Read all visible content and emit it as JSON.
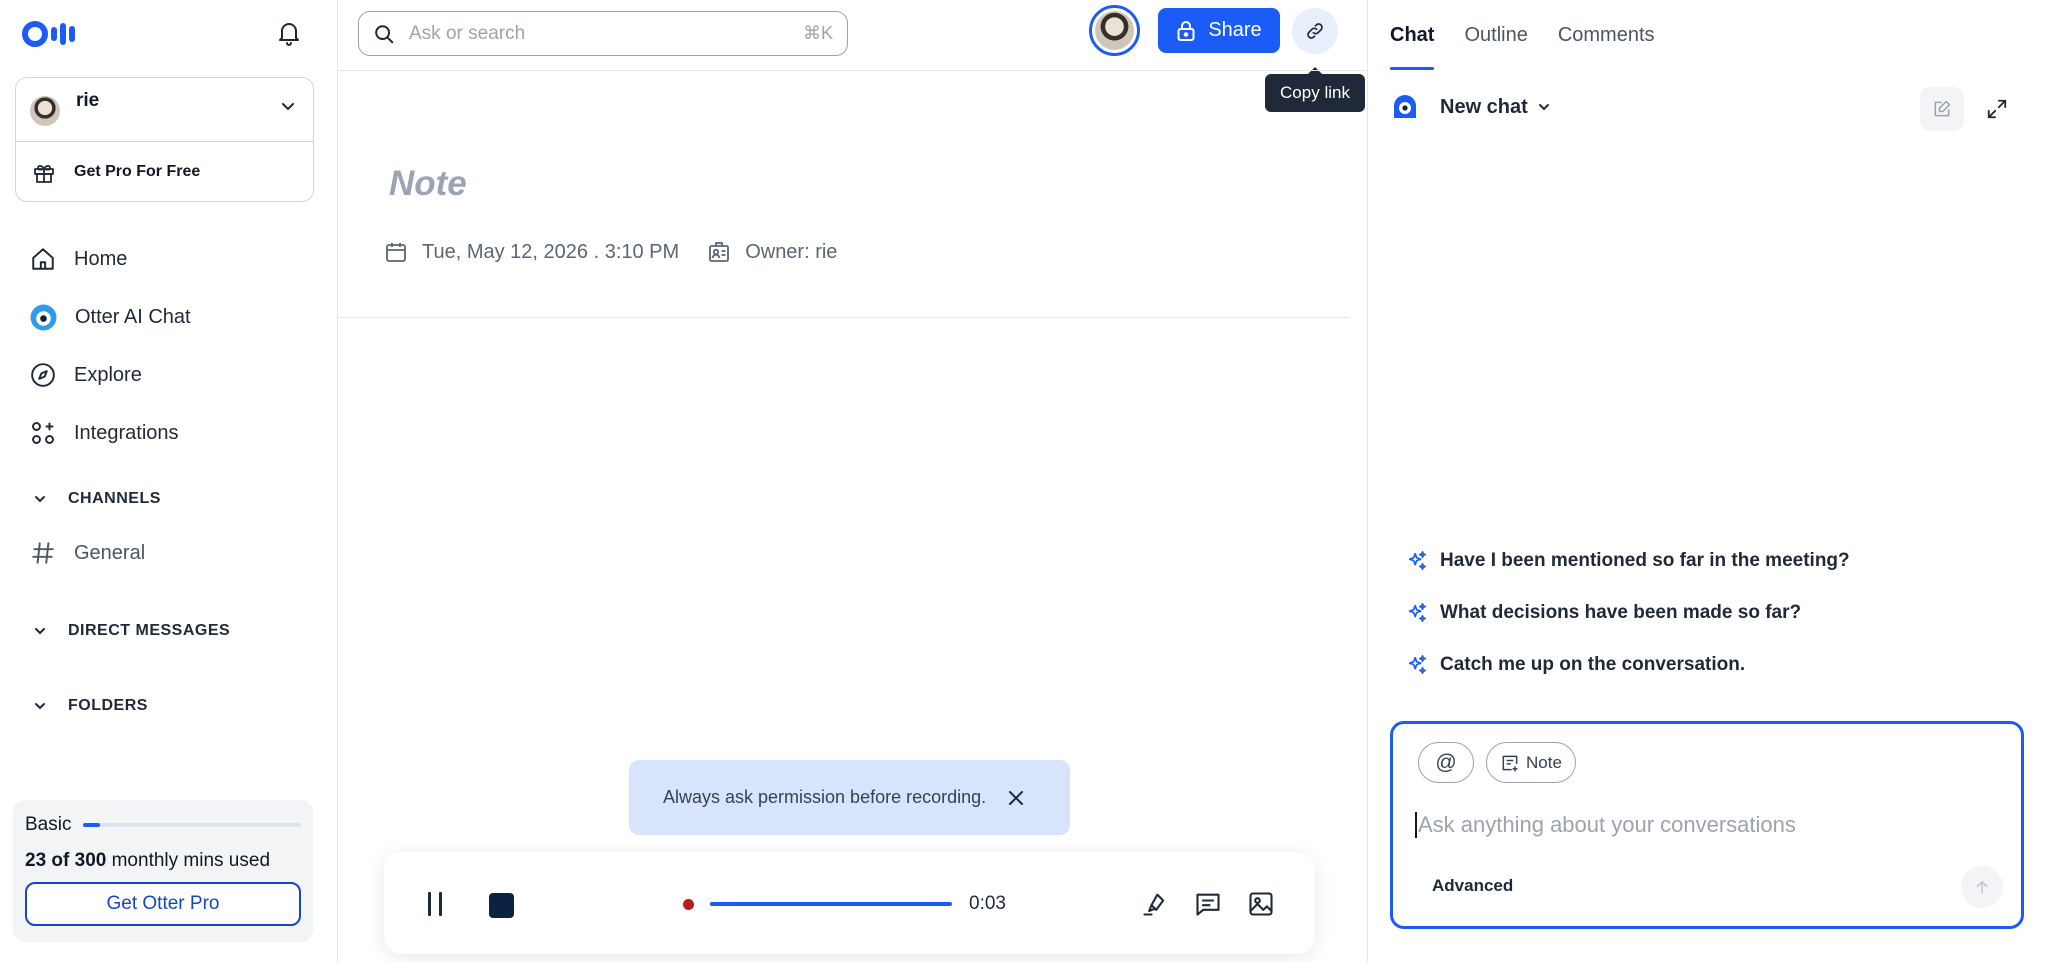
{
  "sidebar": {
    "user": {
      "name": "rie"
    },
    "promo_label": "Get Pro For Free",
    "nav": [
      {
        "label": "Home",
        "icon": "home-icon"
      },
      {
        "label": "Otter AI Chat",
        "icon": "otter-ai-icon"
      },
      {
        "label": "Explore",
        "icon": "compass-icon"
      },
      {
        "label": "Integrations",
        "icon": "integrations-icon"
      }
    ],
    "sections": {
      "channels": "CHANNELS",
      "direct_messages": "DIRECT MESSAGES",
      "folders": "FOLDERS"
    },
    "channel_general": "General",
    "plan": {
      "name": "Basic",
      "used": "23 of 300",
      "usage_suffix": " monthly mins used",
      "usage_fraction": 0.077,
      "cta": "Get Otter Pro"
    }
  },
  "topbar": {
    "search_placeholder": "Ask or search",
    "search_shortcut": "⌘K",
    "share_label": "Share",
    "copy_link_tooltip": "Copy link"
  },
  "note": {
    "title_placeholder": "Note",
    "date": "Tue, May 12, 2026 . 3:10 PM",
    "owner": "Owner: rie"
  },
  "toast": {
    "message": "Always ask permission before recording."
  },
  "recorder": {
    "time": "0:03",
    "progress_fraction": 1.0
  },
  "right_panel": {
    "tabs": [
      "Chat",
      "Outline",
      "Comments"
    ],
    "active_tab": "Chat",
    "chat_title": "New chat",
    "suggestions": [
      "Have I been mentioned so far in the meeting?",
      "What decisions have been made so far?",
      "Catch me up on the conversation."
    ],
    "composer": {
      "chip_mention": "@",
      "chip_note": "Note",
      "placeholder": "Ask anything about your conversations",
      "advanced_label": "Advanced"
    }
  },
  "colors": {
    "brand": "#1a5cf5",
    "recording_dot": "#b91c1c",
    "toast_bg": "#d7e4fb"
  }
}
